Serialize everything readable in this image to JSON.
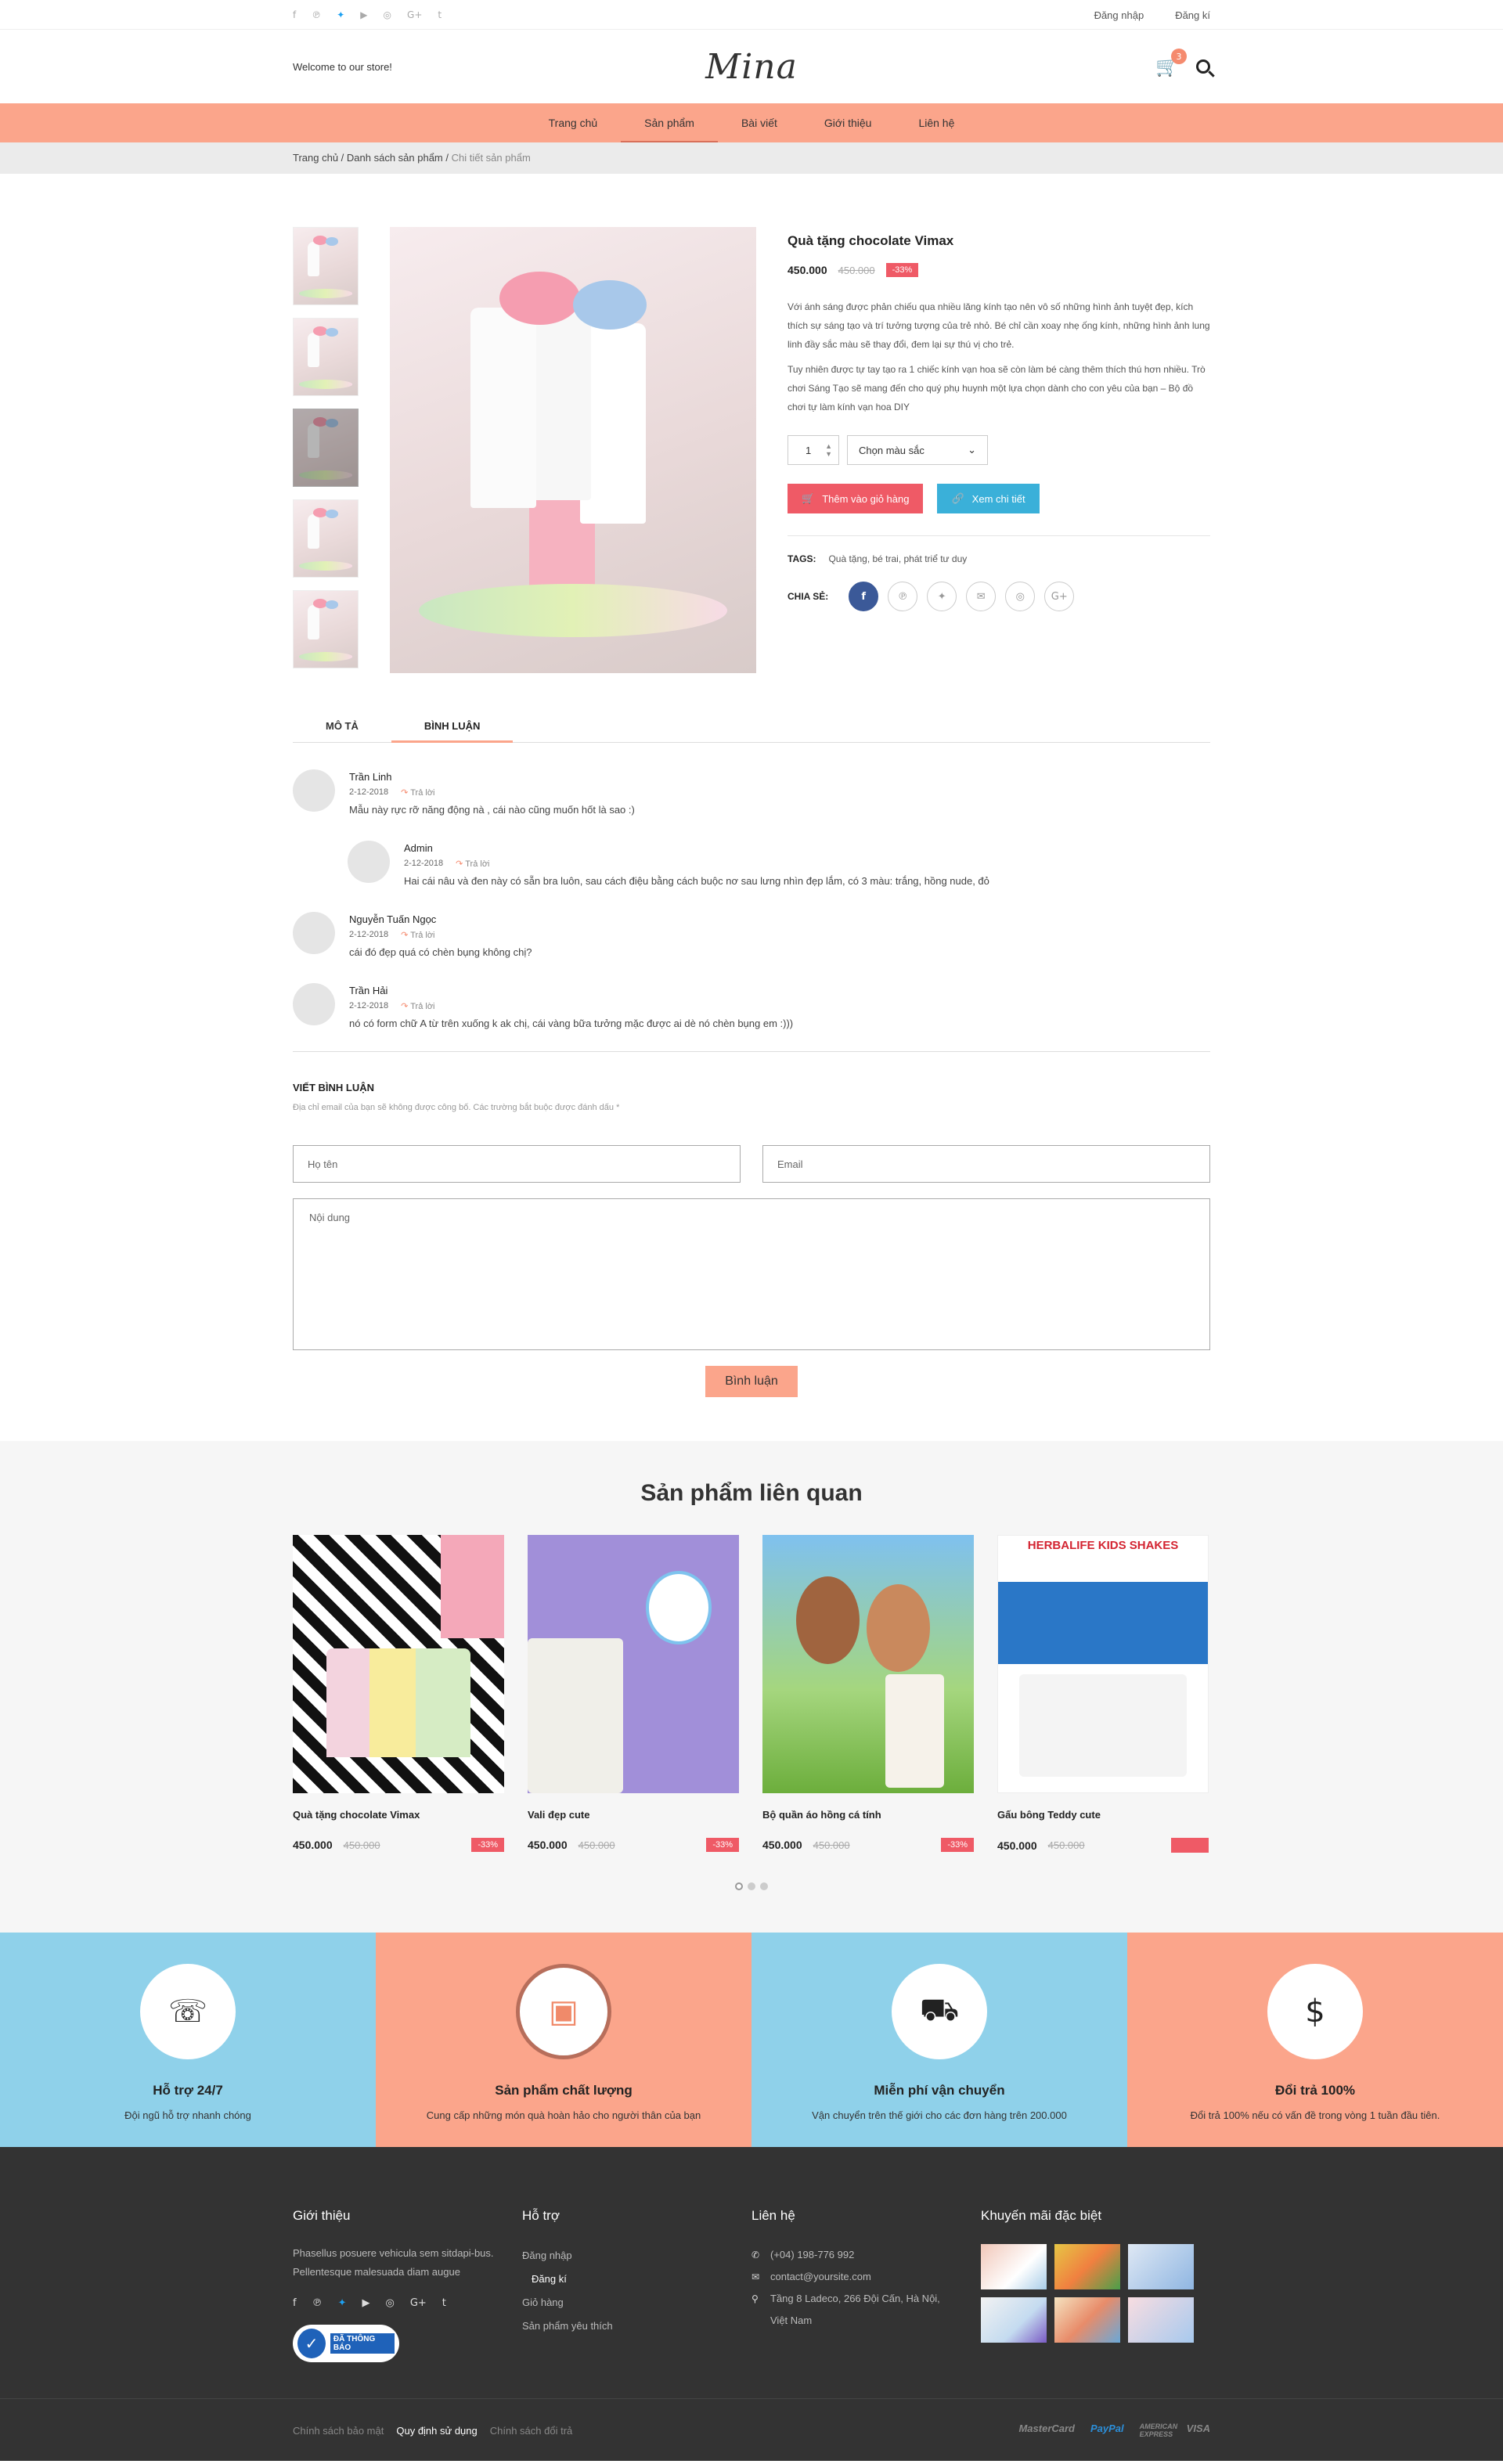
{
  "topbar": {
    "social_icons": [
      "facebook-icon",
      "pinterest-icon",
      "twitter-icon",
      "youtube-icon",
      "instagram-icon",
      "google-plus-icon",
      "tumblr-icon"
    ],
    "login": "Đăng nhập",
    "register": "Đăng kí"
  },
  "header": {
    "welcome": "Welcome to our store!",
    "logo": "Mina",
    "cart_count": "3"
  },
  "nav": {
    "items": [
      "Trang chủ",
      "Sản phẩm",
      "Bài viết",
      "Giới thiệu",
      "Liên hệ"
    ],
    "active": "Sản phẩm"
  },
  "breadcrumb": {
    "home": "Trang chủ /",
    "list": "Danh sách sản phẩm /",
    "current": "Chi tiết sản phẩm"
  },
  "product": {
    "title": "Quà tặng chocolate Vimax",
    "price": "450.000",
    "old_price": "450.000",
    "discount": "-33%",
    "desc1": "Với ánh sáng được phản chiếu qua nhiều lăng kính tạo nên vô số những hình ảnh tuyệt đẹp, kích thích sự sáng tạo và trí tưởng tượng của trẻ nhỏ. Bé chỉ cần xoay nhẹ ống kính, những hình ảnh lung linh đầy sắc màu sẽ thay đổi, đem lại sự thú vị cho trẻ.",
    "desc2": "Tuy nhiên được tự tay tạo ra 1 chiếc kính vạn hoa sẽ còn làm bé càng thêm thích thú hơn nhiều. Trò chơi Sáng Tạo sẽ mang đến cho quý phụ huynh một lựa chọn dành cho con yêu của bạn – Bộ đồ chơi tự làm kính vạn hoa DIY",
    "qty": "1",
    "color_select": "Chọn màu sắc",
    "add_to_cart": "Thêm vào giỏ hàng",
    "view_detail": "Xem chi tiết",
    "tags_label": "TAGS:",
    "tags": "Quà tặng, bé trai, phát triể tư duy",
    "share_label": "CHIA SẺ:",
    "share_icons": [
      "facebook-icon",
      "pinterest-icon",
      "twitter-icon",
      "email-icon",
      "instagram-icon",
      "google-plus-icon"
    ]
  },
  "tabs": [
    "MÔ TẢ",
    "BÌNH LUẬN"
  ],
  "comments": [
    {
      "name": "Trần Linh",
      "date": "2-12-2018",
      "reply": "Trả lời",
      "text": "Mẫu này rực rỡ năng động nà , cái nào cũng muốn hốt là sao :)"
    },
    {
      "name": "Admin",
      "date": "2-12-2018",
      "reply": "Trả lời",
      "text": "Hai cái nâu và đen này có sẵn bra luôn, sau cách điệu bằng cách buộc nơ sau lưng nhìn đẹp lắm,  có 3 màu: trắng, hồng nude, đỏ"
    },
    {
      "name": "Nguyễn Tuấn Ngọc",
      "date": "2-12-2018",
      "reply": "Trả lời",
      "text": "cái đó đẹp quá có chèn bụng không chị?"
    },
    {
      "name": "Trần Hải",
      "date": "2-12-2018",
      "reply": "Trả lời",
      "text": "nó có form chữ A từ trên xuống k ak chị, cái vàng bữa tưởng mặc được ai dè nó chèn bụng em :)))"
    }
  ],
  "write": {
    "title": "VIẾT BÌNH LUẬN",
    "note": "Địa chỉ email của bạn sẽ không được công bố. Các trường bắt buộc được đánh dấu *",
    "name_ph": "Họ tên",
    "email_ph": "Email",
    "content_ph": "Nội dung",
    "submit": "Bình luận"
  },
  "related": {
    "title": "Sản phẩm liên quan",
    "items": [
      {
        "name": "Quà tặng chocolate Vimax",
        "price": "450.000",
        "old": "450.000",
        "sale": "-33%"
      },
      {
        "name": "Vali đẹp cute",
        "price": "450.000",
        "old": "450.000",
        "sale": "-33%"
      },
      {
        "name": "Bộ quần áo hồng cá tính",
        "price": "450.000",
        "old": "450.000",
        "sale": "-33%"
      },
      {
        "name": "Gấu bông Teddy cute",
        "price": "450.000",
        "old": "450.000",
        "sale": ""
      }
    ],
    "herb_title": "HERBALIFE KIDS SHAKES"
  },
  "features": [
    {
      "title": "Hỗ trợ 24/7",
      "text": "Đội ngũ hỗ trợ nhanh chóng",
      "icon": "phone-24-icon"
    },
    {
      "title": "Sản phẩm chất lượng",
      "text": "Cung cấp những món quà hoàn hảo cho người thân của bạn",
      "icon": "box-icon"
    },
    {
      "title": "Miễn phí vận chuyển",
      "text": "Vận chuyển trên thế giới cho các đơn hàng trên  200.000",
      "icon": "truck-icon"
    },
    {
      "title": "Đổi trả 100%",
      "text": "Đổi trả 100% nếu có vấn đề trong vòng 1 tuần đầu tiên.",
      "icon": "coins-icon"
    }
  ],
  "footer": {
    "about_title": "Giới thiệu",
    "about_text": "Phasellus posuere vehicula sem sitdapi-bus. Pellentesque malesuada diam augue",
    "cert": "ĐÃ THÔNG BÁO",
    "support_title": "Hỗ trợ",
    "support_links": [
      "Đăng nhập",
      "Đăng kí",
      "Giỏ hàng",
      "Sản phẩm yêu thích"
    ],
    "contact_title": "Liên hệ",
    "phone": "(+04) 198-776 992",
    "email": "contact@yoursite.com",
    "address": "Tầng 8 Ladeco, 266 Đội Cấn, Hà Nội, Việt Nam",
    "promo_title": "Khuyến mãi đặc biệt",
    "policies": [
      "Chính sách bảo mật",
      "Quy định sử dụng",
      "Chính sách đổi trả"
    ],
    "payments": [
      "MasterCard",
      "PayPal",
      "AMERICAN EXPRESS",
      "VISA"
    ]
  }
}
